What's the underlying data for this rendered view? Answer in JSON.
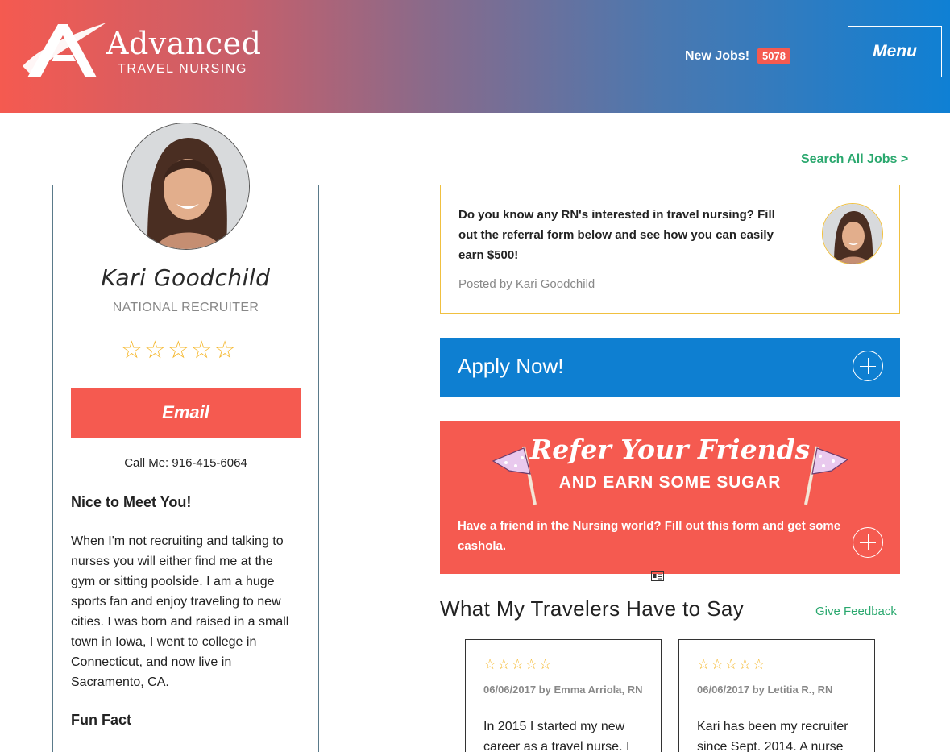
{
  "header": {
    "logo_word": "Advanced",
    "logo_sub": "TRAVEL NURSING",
    "new_jobs_label": "New Jobs!",
    "new_jobs_count": "5078",
    "menu_label": "Menu"
  },
  "profile": {
    "name": "Kari Goodchild",
    "role": "NATIONAL RECRUITER",
    "rating_stars": 5,
    "email_label": "Email",
    "call_me": "Call Me: 916-415-6064",
    "nice_heading": "Nice to Meet You!",
    "bio": "When I'm not recruiting and talking to nurses you will either find me at the gym or sitting poolside. I am a huge sports fan and enjoy traveling to new cities. I was born and raised in a small town in Iowa, I went to college in Connecticut, and now live in Sacramento, CA.",
    "fun_fact_heading": "Fun Fact"
  },
  "main": {
    "search_all": "Search All Jobs >",
    "post": {
      "text": "Do you know any RN's interested in travel nursing? Fill out the referral form below and see how you can easily earn $500!",
      "posted_by": "Posted by Kari Goodchild"
    },
    "apply_label": "Apply Now!",
    "refer": {
      "title": "Refer Your Friends",
      "subtitle": "AND EARN SOME SUGAR",
      "text": "Have a friend in the Nursing world? Fill out this form and get some cashola."
    },
    "travelers_heading": "What My Travelers Have to Say",
    "give_feedback": "Give Feedback",
    "reviews": [
      {
        "meta": "06/06/2017 by Emma Arriola, RN",
        "text": "In 2015 I started my new career as a travel nurse. I"
      },
      {
        "meta": "06/06/2017 by Letitia R., RN",
        "text": "Kari has been my recruiter since Sept. 2014. A nurse"
      }
    ]
  },
  "colors": {
    "coral": "#f55a50",
    "blue": "#0e7fd1",
    "green_link": "#2aa86e",
    "star_gold": "#f5b82e"
  }
}
